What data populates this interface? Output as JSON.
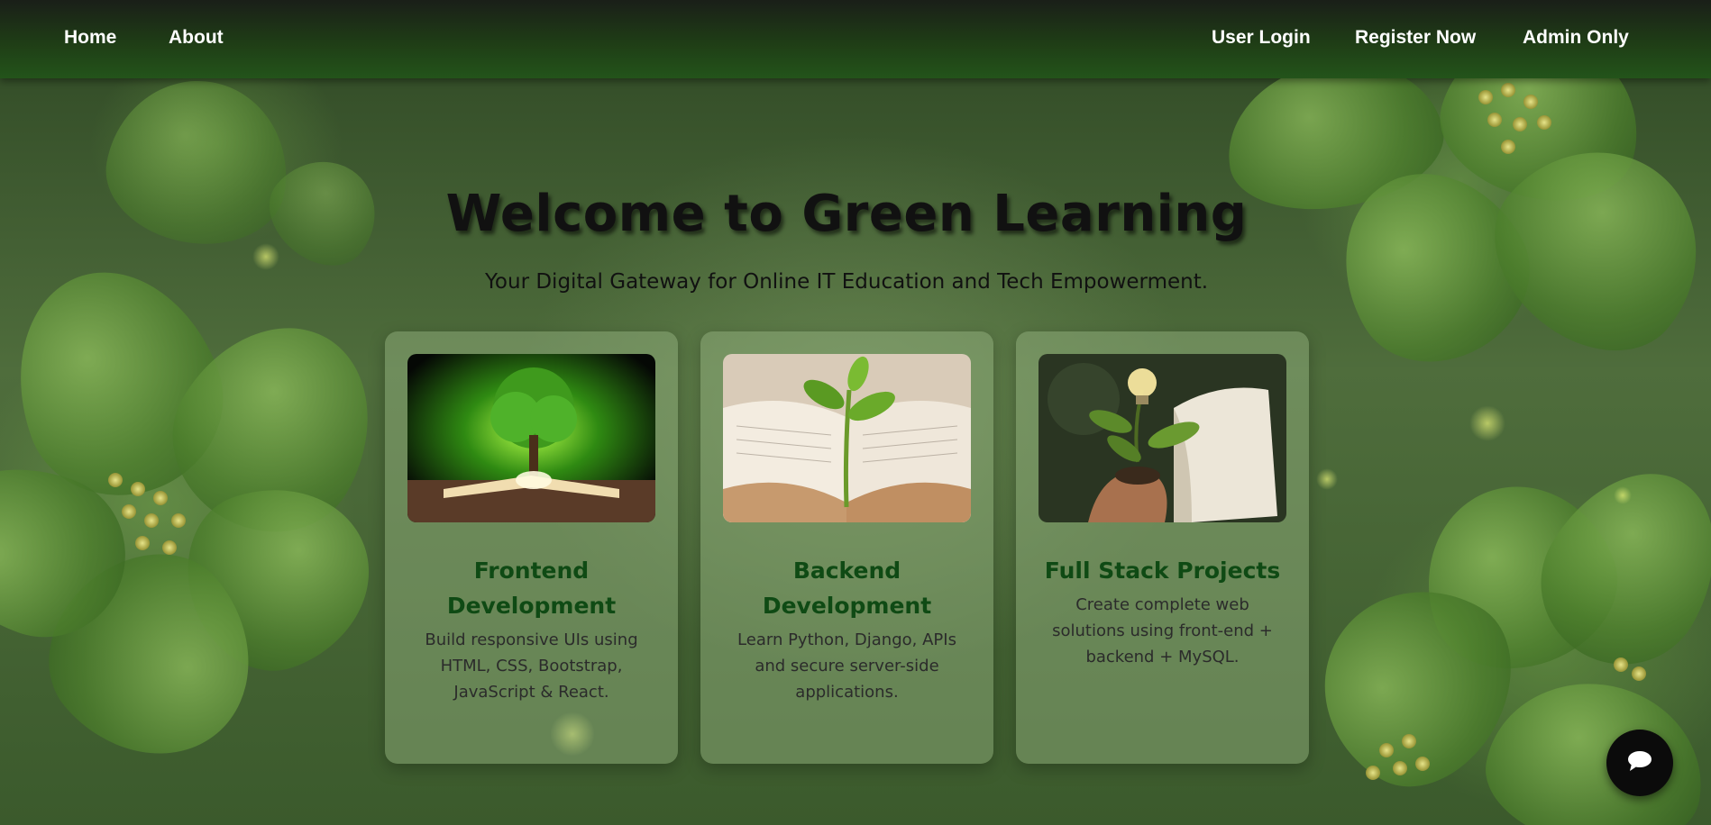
{
  "nav": {
    "left": [
      {
        "label": "Home"
      },
      {
        "label": "About"
      }
    ],
    "right": [
      {
        "label": "User Login"
      },
      {
        "label": "Register Now"
      },
      {
        "label": "Admin Only"
      }
    ]
  },
  "hero": {
    "title": "Welcome to Green Learning",
    "subtitle": "Your Digital Gateway for Online IT Education and Tech Empowerment."
  },
  "cards": [
    {
      "title_line1": "Frontend",
      "title_line2": "Development",
      "lines": [
        "Build responsive UIs using",
        "HTML, CSS, Bootstrap,",
        "JavaScript & React."
      ]
    },
    {
      "title_line1": "Backend",
      "title_line2": "Development",
      "lines": [
        "Learn Python, Django, APIs",
        "and secure server-side",
        "applications."
      ]
    },
    {
      "title_line1": "Full Stack Projects",
      "title_line2": "",
      "lines": [
        "Create complete web",
        "solutions using front-end +",
        "backend + MySQL."
      ]
    }
  ],
  "chat": {
    "icon": "chat-bubble-icon"
  },
  "colors": {
    "nav_bg": "#1f3d16",
    "card_title": "#0f4a14",
    "accent_green": "#4d7f2c"
  }
}
